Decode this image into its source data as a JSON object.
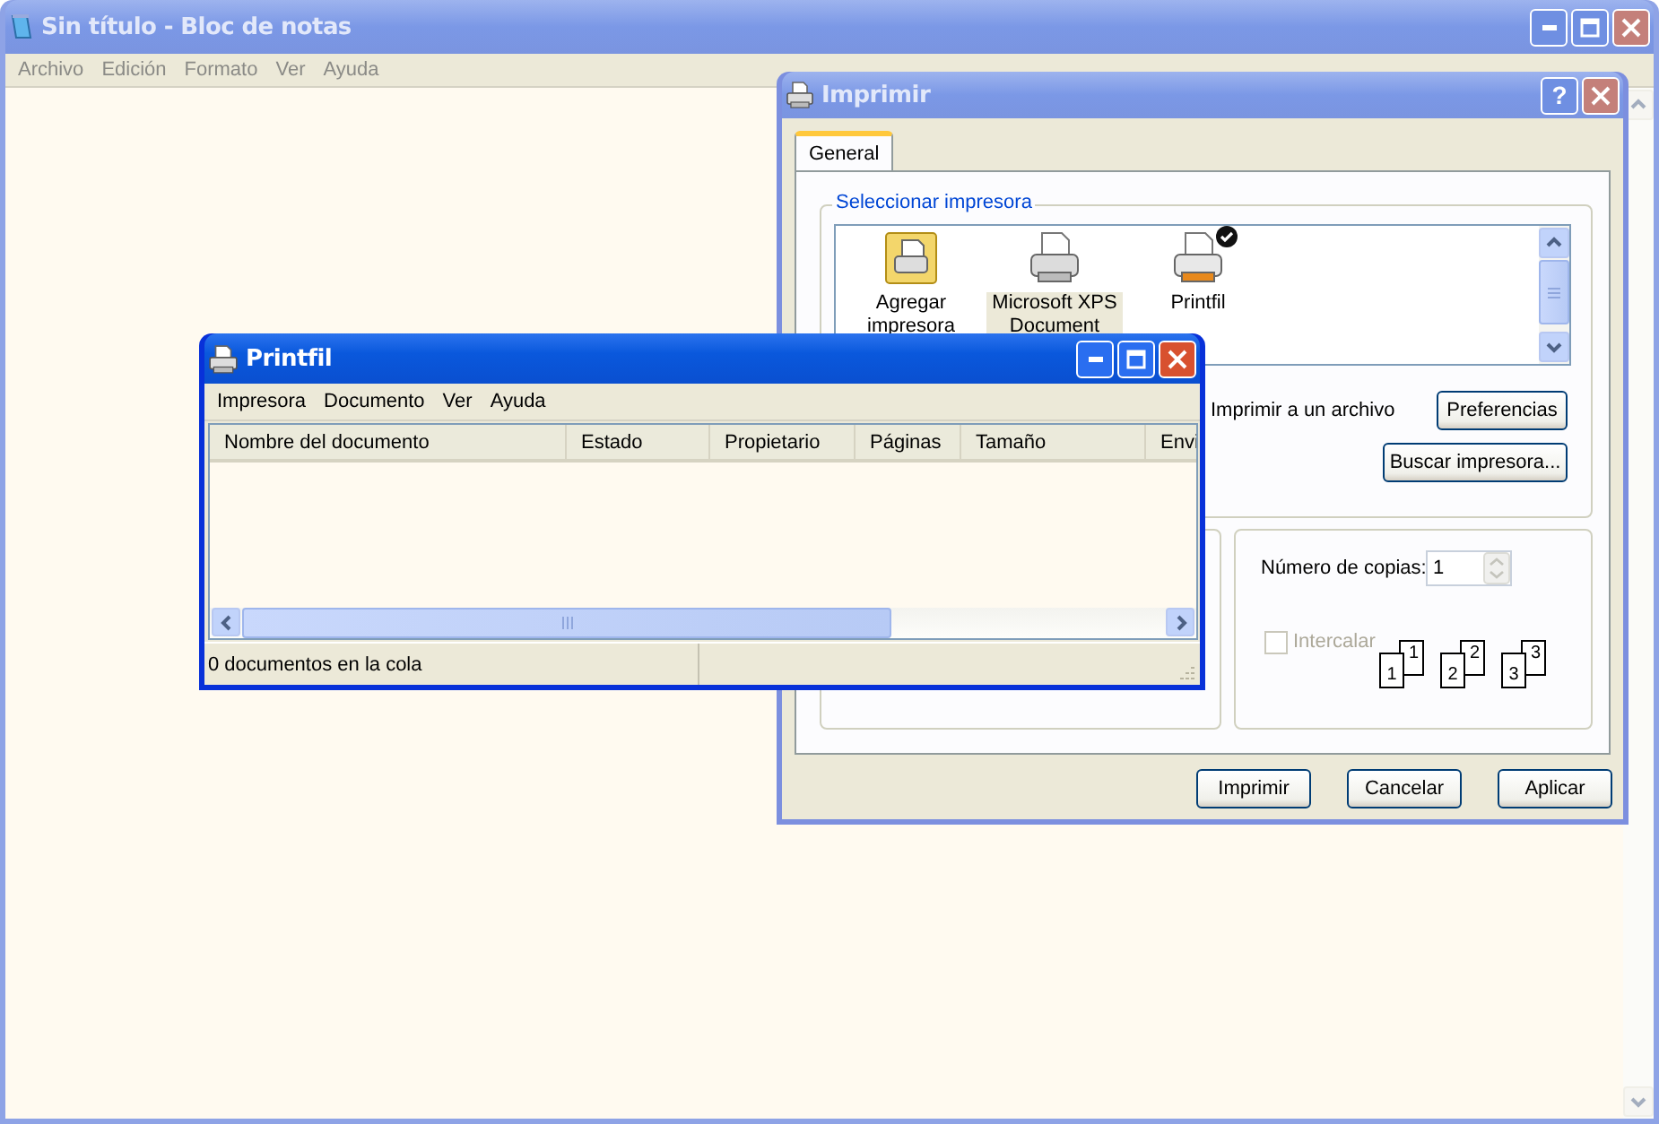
{
  "notepad": {
    "title": "Sin título - Bloc de notas",
    "active": false,
    "menu": [
      "Archivo",
      "Edición",
      "Formato",
      "Ver",
      "Ayuda"
    ]
  },
  "print_dialog": {
    "title": "Imprimir",
    "active": false,
    "help_button": "?",
    "tabs": [
      {
        "label": "General",
        "selected": true
      }
    ],
    "printer_group": {
      "title": "Seleccionar impresora",
      "printers": [
        {
          "kind": "add",
          "name": "Agregar impresora",
          "selected": false,
          "default": false
        },
        {
          "kind": "printer",
          "name": "Microsoft XPS Document",
          "selected": true,
          "default": false
        },
        {
          "kind": "printer",
          "name": "Printfil",
          "selected": false,
          "default": true
        }
      ]
    },
    "print_to_file": "Imprimir a un archivo",
    "preferences_button": "Preferencias",
    "find_printer_button": "Buscar impresora...",
    "copies": {
      "label": "Número de copias:",
      "value": "1"
    },
    "collate": {
      "label": "Intercalar",
      "checked": false,
      "disabled": true
    },
    "collate_pages": [
      [
        "1",
        "1"
      ],
      [
        "2",
        "2"
      ],
      [
        "3",
        "3"
      ]
    ],
    "buttons": [
      "Imprimir",
      "Cancelar",
      "Aplicar"
    ]
  },
  "printfil": {
    "title": "Printfil",
    "active": true,
    "menu": [
      "Impresora",
      "Documento",
      "Ver",
      "Ayuda"
    ],
    "columns": [
      "Nombre del documento",
      "Estado",
      "Propietario",
      "Páginas",
      "Tamaño",
      "Envi"
    ],
    "status": [
      "0 documentos en la cola"
    ]
  }
}
